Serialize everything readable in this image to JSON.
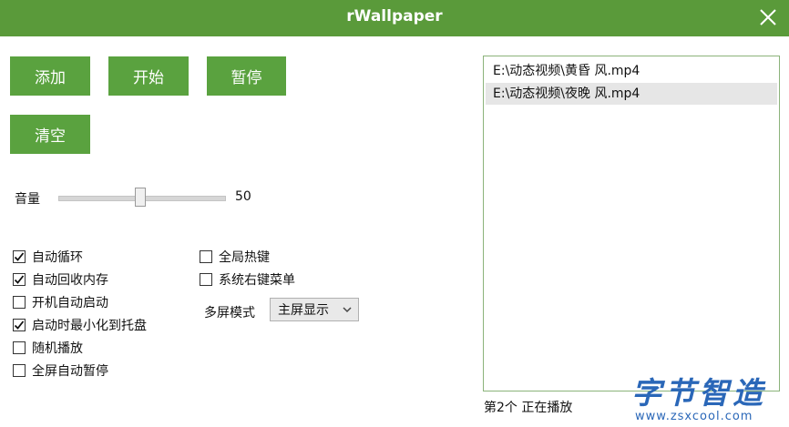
{
  "window": {
    "title": "rWallpaper",
    "close_icon": "close-icon"
  },
  "buttons": {
    "add": "添加",
    "start": "开始",
    "pause": "暂停",
    "clear": "清空"
  },
  "volume": {
    "label": "音量",
    "value": "50",
    "level_percent": 50
  },
  "options_left": [
    {
      "label": "自动循环",
      "checked": true
    },
    {
      "label": "自动回收内存",
      "checked": true
    },
    {
      "label": "开机自动启动",
      "checked": false
    },
    {
      "label": "启动时最小化到托盘",
      "checked": true
    },
    {
      "label": "随机播放",
      "checked": false
    },
    {
      "label": "全屏自动暂停",
      "checked": false
    }
  ],
  "options_right": [
    {
      "label": "全局热键",
      "checked": false
    },
    {
      "label": "系统右键菜单",
      "checked": false
    }
  ],
  "multiscreen": {
    "label": "多屏模式",
    "selected": "主屏显示",
    "dropdown_icon": "chevron-down-icon"
  },
  "playlist": {
    "items": [
      {
        "path": "E:\\动态视频\\黄昏 风.mp4",
        "selected": false
      },
      {
        "path": "E:\\动态视频\\夜晚 风.mp4",
        "selected": true
      }
    ],
    "status": "第2个  正在播放"
  },
  "watermark": {
    "text": "字节智造",
    "url": "www.zsxcool.com"
  },
  "colors": {
    "titlebar": "#5a9a3a",
    "button": "#5aa23f",
    "watermark": "#2a67b8"
  }
}
